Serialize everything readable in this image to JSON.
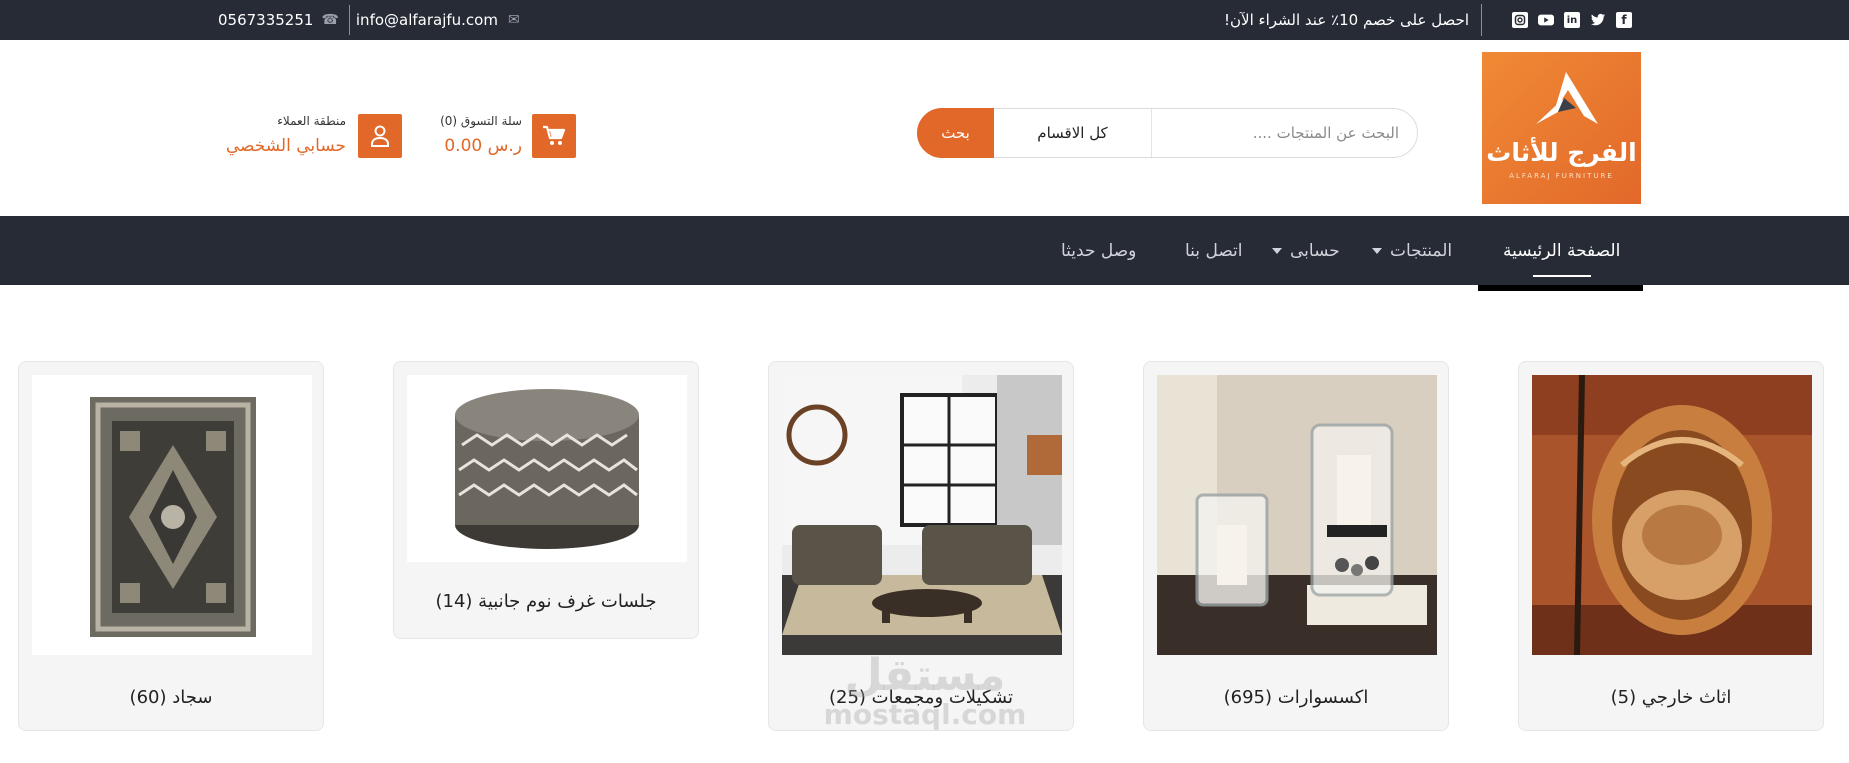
{
  "topbar": {
    "phone": "0567335251",
    "email": "info@alfarajfu.com",
    "promo": "احصل على خصم 10٪ عند الشراء الآن!",
    "social": [
      "instagram-icon",
      "youtube-icon",
      "linkedin-icon",
      "twitter-icon",
      "facebook-icon"
    ]
  },
  "logo": {
    "arabic": "الفرج للأثاث",
    "english": "ALFARAJ FURNITURE"
  },
  "search": {
    "placeholder": "البحث عن المنتجات ....",
    "category": "كل الاقسام",
    "button": "بحث"
  },
  "cart": {
    "label": "سلة التسوق (0)",
    "total": "0.00 ر.س"
  },
  "account": {
    "label": "منطقة العملاء",
    "link": "حسابي الشخصي"
  },
  "nav": {
    "items": [
      {
        "label": "الصفحة الرئيسية",
        "active": true
      },
      {
        "label": "المنتجات",
        "dropdown": true
      },
      {
        "label": "حسابى",
        "dropdown": true
      },
      {
        "label": "اتصل بنا"
      },
      {
        "label": "وصل حديثا"
      }
    ]
  },
  "categories": [
    {
      "title": "اثاث خارجي (5)"
    },
    {
      "title": "اكسسوارات (695)"
    },
    {
      "title": "تشكيلات ومجمعات (25)"
    },
    {
      "title": "جلسات غرف نوم جانبية (14)"
    },
    {
      "title": "سجاد (60)"
    }
  ],
  "watermark": {
    "arabic": "مستقل",
    "latin": "mostaql.com"
  },
  "colors": {
    "accent": "#e2682a",
    "dark": "#272b35"
  }
}
